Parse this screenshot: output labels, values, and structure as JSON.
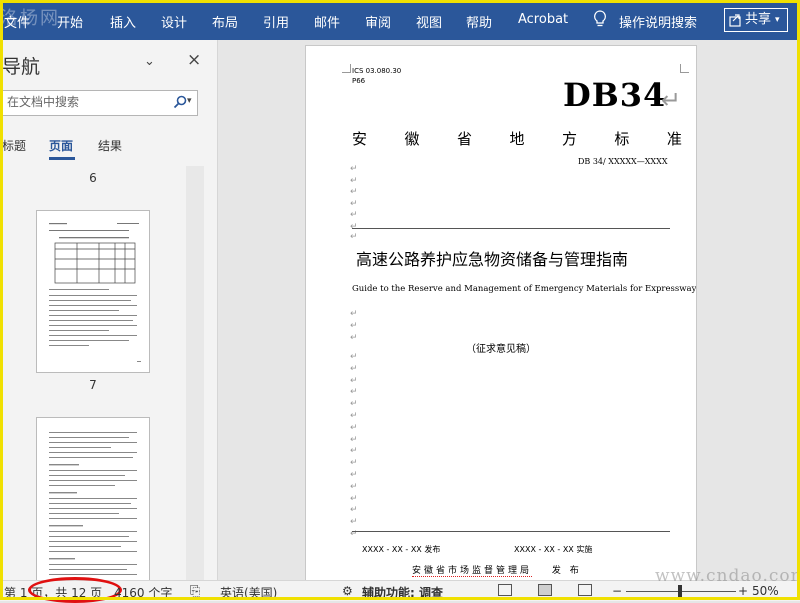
{
  "watermark_top": "洛杨网",
  "watermark_bottom": "www.cndao.com",
  "ribbon": {
    "tabs": [
      "文件",
      "开始",
      "插入",
      "设计",
      "布局",
      "引用",
      "邮件",
      "审阅",
      "视图",
      "帮助",
      "Acrobat"
    ],
    "tell_me": "操作说明搜索",
    "share": "共享"
  },
  "nav": {
    "title": "导航",
    "search_placeholder": "在文档中搜索",
    "tabs": [
      "标题",
      "页面",
      "结果"
    ],
    "active_tab": "页面",
    "page_numbers": [
      "6",
      "7"
    ]
  },
  "document": {
    "ics": "ICS 03.080.30",
    "ccs": "P66",
    "std_code": "DB34",
    "province_chars": [
      "安",
      "徽",
      "省",
      "地",
      "方",
      "标",
      "准"
    ],
    "std_number": "DB 34/ XXXXX—XXXX",
    "title_cn": "高速公路养护应急物资储备与管理指南",
    "title_en": "Guide to the Reserve and Management of Emergency Materials for Expressway Maintenance",
    "draft_label": "（征求意见稿）",
    "publish": "XXXX - XX - XX 发布",
    "implement": "XXXX - XX - XX 实施",
    "issuer": "安徽省市场监督管理局",
    "issuer_suffix": "发 布"
  },
  "status": {
    "page": "第 1 页，共 12 页",
    "words": "4160 个字",
    "language": "英语(美国)",
    "accessibility": "辅助功能: 调查",
    "zoom": "50%"
  },
  "colors": {
    "ribbon": "#2b579a",
    "frame": "#f0e000",
    "highlight_oval": "#e01010"
  }
}
